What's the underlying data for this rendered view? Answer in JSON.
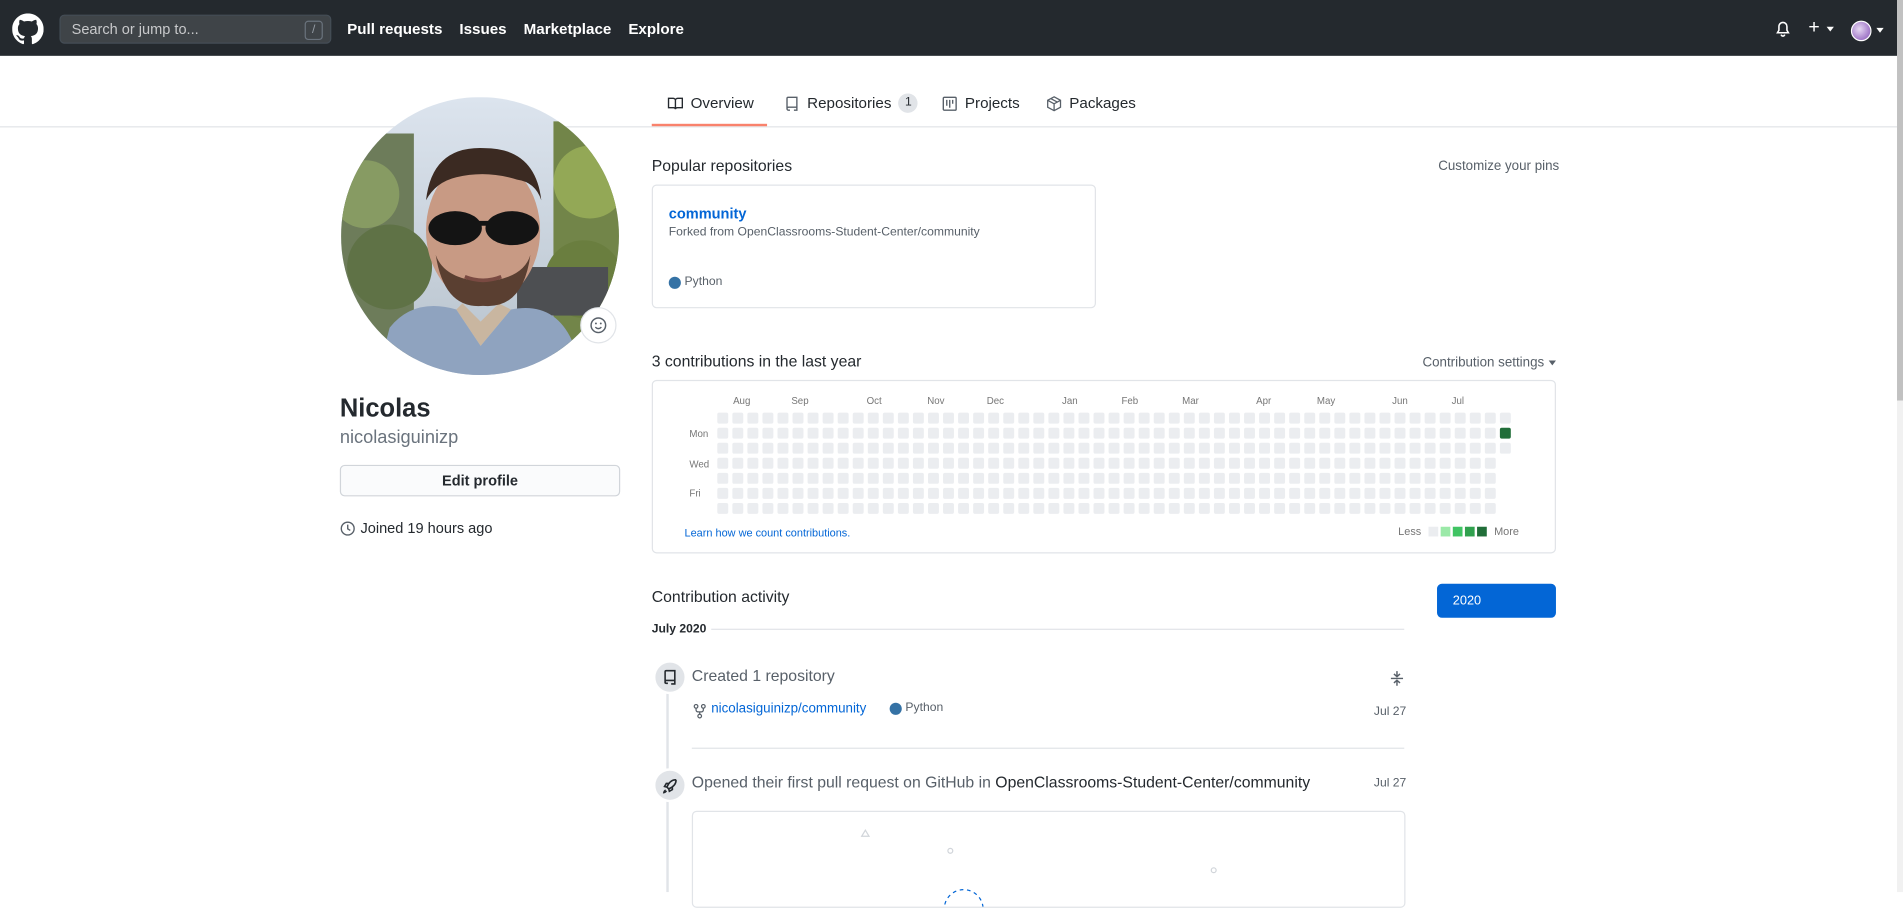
{
  "header": {
    "search_placeholder": "Search or jump to...",
    "search_shortcut": "/",
    "nav": [
      "Pull requests",
      "Issues",
      "Marketplace",
      "Explore"
    ],
    "plus_label": "+"
  },
  "tabs": [
    {
      "label": "Overview",
      "icon": "book-icon",
      "selected": true
    },
    {
      "label": "Repositories",
      "icon": "repo-icon",
      "count": "1"
    },
    {
      "label": "Projects",
      "icon": "project-icon"
    },
    {
      "label": "Packages",
      "icon": "package-icon"
    }
  ],
  "profile": {
    "name": "Nicolas",
    "login": "nicolasiguinizp",
    "edit_label": "Edit profile",
    "joined": "Joined 19 hours ago"
  },
  "popular": {
    "heading": "Popular repositories",
    "customize": "Customize your pins",
    "repo": {
      "name": "community",
      "forked_from": "Forked from OpenClassrooms-Student-Center/community",
      "language": "Python",
      "language_color": "#3572A5"
    }
  },
  "contributions": {
    "heading": "3 contributions in the last year",
    "settings": "Contribution settings",
    "months": [
      "Aug",
      "Sep",
      "Oct",
      "Nov",
      "Dec",
      "Jan",
      "Feb",
      "Mar",
      "Apr",
      "May",
      "Jun",
      "Jul"
    ],
    "days": [
      "Mon",
      "Wed",
      "Fri"
    ],
    "learn": "Learn how we count contributions.",
    "less": "Less",
    "more": "More",
    "colors": [
      "#ebedf0",
      "#9be9a8",
      "#40c463",
      "#30a14e",
      "#216e39"
    ],
    "weeks": 53,
    "active_cell": {
      "week": 52,
      "day": 1,
      "level": 4
    }
  },
  "activity": {
    "heading": "Contribution activity",
    "year": "2020",
    "month": "July 2020",
    "events": [
      {
        "title": "Created 1 repository",
        "repo": "nicolasiguinizp/community",
        "language": "Python",
        "date": "Jul 27"
      },
      {
        "title_prefix": "Opened their first pull request on GitHub in",
        "title_repo": "OpenClassrooms-Student-Center/community",
        "date": "Jul 27"
      }
    ]
  }
}
